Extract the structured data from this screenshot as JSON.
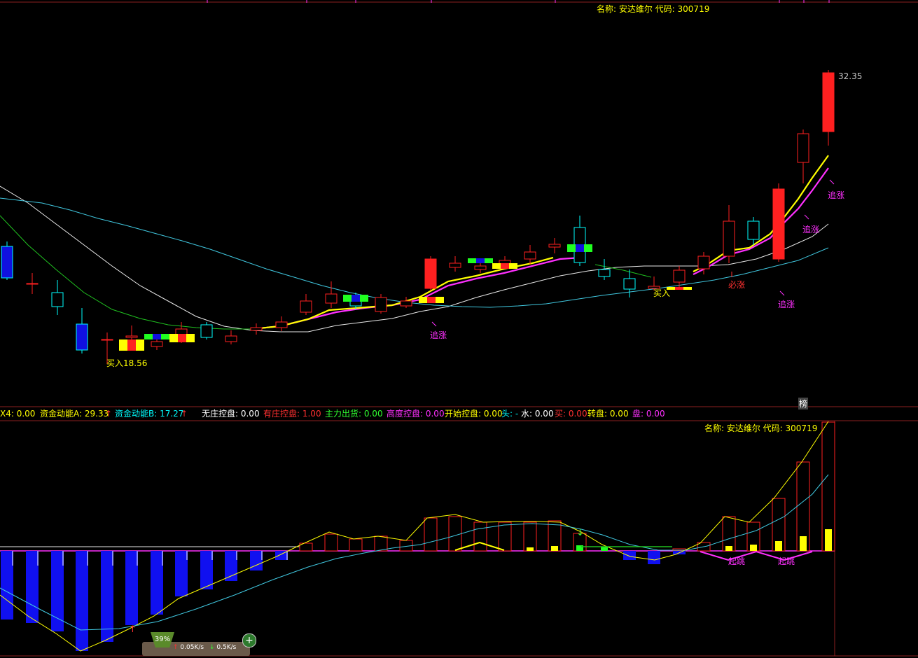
{
  "top_panel": {
    "stock_label": "名称: 安达维尔 代码: 300719",
    "price_high_label": "32.35",
    "price_low_label": "买入18.56",
    "side_tag": "榜",
    "signals": [
      {
        "text": "追涨",
        "color": "#ff30ff"
      },
      {
        "text": "买入",
        "color": "#ffff00"
      },
      {
        "text": "必涨",
        "color": "#ff3030"
      },
      {
        "text": "追涨",
        "color": "#ff30ff"
      },
      {
        "text": "追涨",
        "color": "#ff30ff"
      },
      {
        "text": "追涨",
        "color": "#ff30ff"
      }
    ]
  },
  "indicator_bar": [
    {
      "text": "X4: 0.00",
      "color": "#ffff00"
    },
    {
      "text": "资金动能A: 29.33",
      "color": "#ffff00"
    },
    {
      "text": "↑",
      "color": "#ff3030"
    },
    {
      "text": "资金动能B: 17.27",
      "color": "#00ffff"
    },
    {
      "text": "↑",
      "color": "#ff3030"
    },
    {
      "text": "无庄控盘: 0.00",
      "color": "#ffffff"
    },
    {
      "text": "有庄控盘: 1.00",
      "color": "#ff3030"
    },
    {
      "text": "主力出货: 0.00",
      "color": "#30ff30"
    },
    {
      "text": "高度控盘: 0.00",
      "color": "#ff30ff"
    },
    {
      "text": "开始控盘: 0.00",
      "color": "#ffff00"
    },
    {
      "text": "头: -",
      "color": "#00ffff"
    },
    {
      "text": "水: 0.00",
      "color": "#ffffff"
    },
    {
      "text": "买: 0.00",
      "color": "#ff3030"
    },
    {
      "text": "转盘: 0.00",
      "color": "#ffff00"
    },
    {
      "text": "盘: 0.00",
      "color": "#ff30ff"
    }
  ],
  "bottom_panel": {
    "stock_label": "名称: 安达维尔 代码: 300719",
    "signals": [
      {
        "text": "起跳",
        "color": "#ff30ff"
      },
      {
        "text": "起跳",
        "color": "#ff30ff"
      }
    ]
  },
  "net_widget": {
    "percent": "39%",
    "upload": "0.05K/s",
    "download": "0.5K/s",
    "plus_icon": "+"
  },
  "colors": {
    "up": "#ff2020",
    "down": "#00ffff",
    "ma_fast": "#ffff00",
    "ma_magenta": "#ff30ff",
    "ma_white": "#e8e8e8",
    "ma_cyan": "#40c8e0",
    "ma_green": "#20c020"
  }
}
